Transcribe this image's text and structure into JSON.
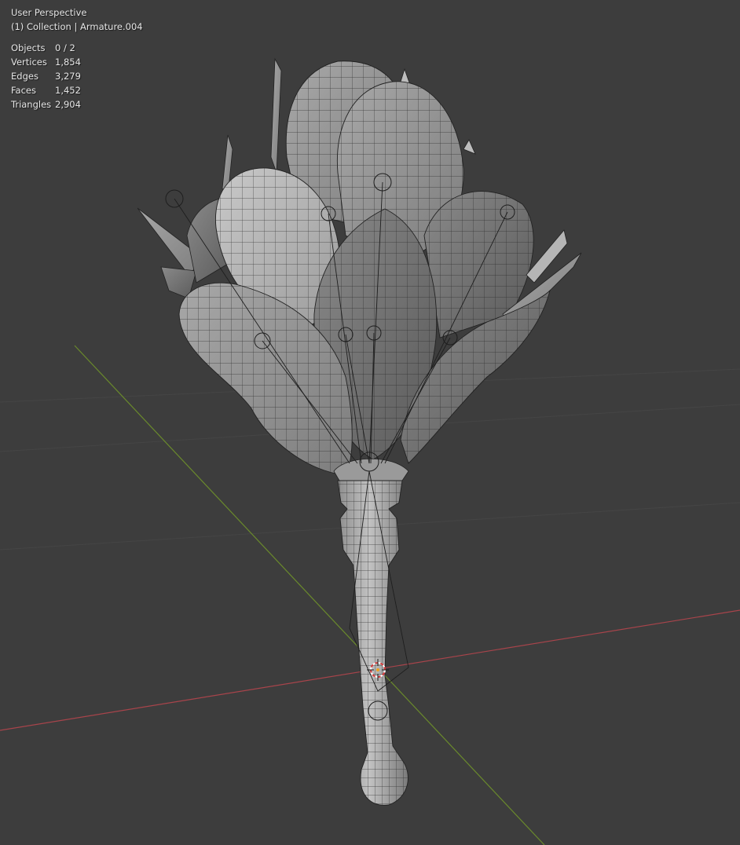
{
  "viewport": {
    "view_name": "User Perspective",
    "collection_label": "(1) Collection | Armature.004",
    "background_color": "#3d3d3d",
    "axis_x_color": "#a8444b",
    "axis_y_color": "#6a8a2c"
  },
  "stats": [
    {
      "label": "Objects",
      "value": "0 / 2"
    },
    {
      "label": "Vertices",
      "value": "1,854"
    },
    {
      "label": "Edges",
      "value": "3,279"
    },
    {
      "label": "Faces",
      "value": "1,452"
    },
    {
      "label": "Triangles",
      "value": "2,904"
    }
  ],
  "icons": {
    "origin_cursor": "3d-cursor-icon"
  }
}
